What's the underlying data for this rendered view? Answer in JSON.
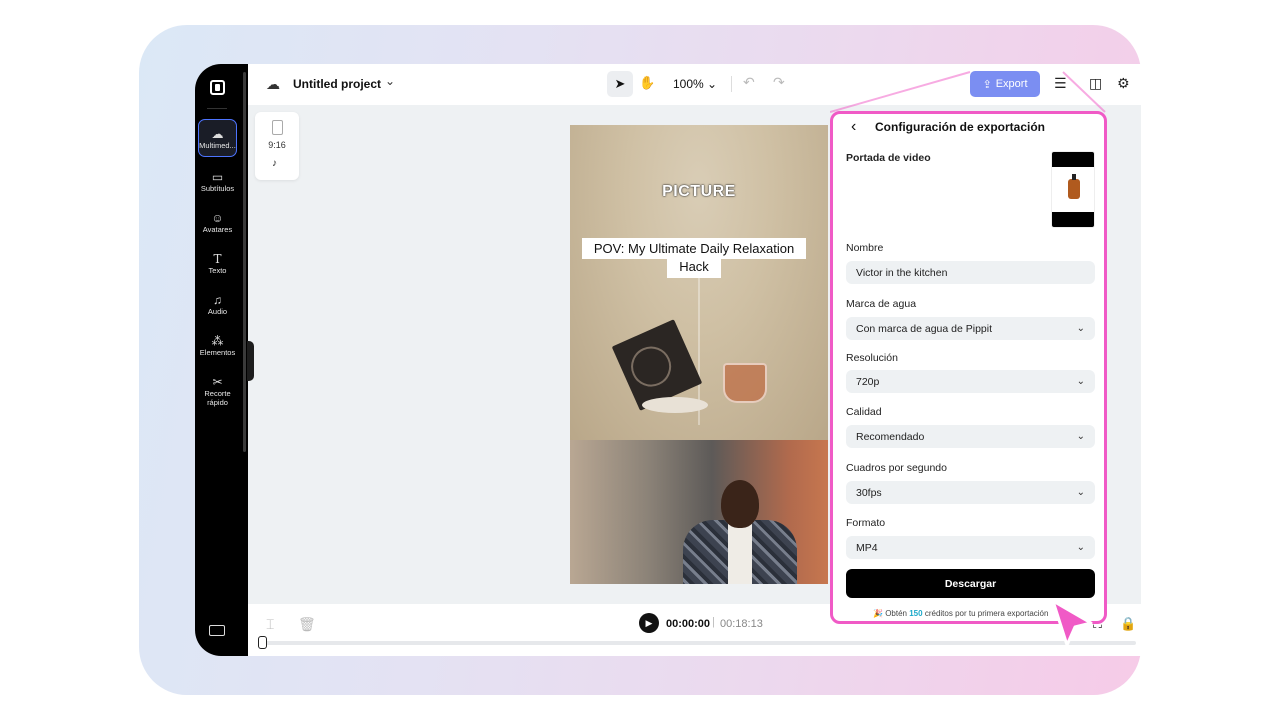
{
  "project": {
    "title": "Untitled project"
  },
  "toolbar": {
    "zoom": "100%",
    "export_label": "Export"
  },
  "sidebar": {
    "items": [
      {
        "label": "Multimed...",
        "icon": "cloud-upload-icon"
      },
      {
        "label": "Subtítulos",
        "icon": "subtitles-icon"
      },
      {
        "label": "Avatares",
        "icon": "avatar-icon"
      },
      {
        "label": "Texto",
        "icon": "text-icon"
      },
      {
        "label": "Audio",
        "icon": "music-icon"
      },
      {
        "label": "Elementos",
        "icon": "elements-icon"
      },
      {
        "label": "Recorte rápido",
        "icon": "quick-cut-icon"
      }
    ]
  },
  "canvas": {
    "aspect_ratio": "9:16",
    "video_title_overlay": "PICTURE",
    "video_caption": "POV: My Ultimate Daily Relaxation",
    "video_caption_line2": "Hack"
  },
  "playback": {
    "current_time": "00:00:00",
    "separator": "|",
    "total_time": "00:18:13"
  },
  "export_panel": {
    "title": "Configuración de exportación",
    "cover_label": "Portada de video",
    "name_label": "Nombre",
    "name_value": "Victor in the kitchen",
    "watermark_label": "Marca de agua",
    "watermark_value": "Con marca de agua de Pippit",
    "resolution_label": "Resolución",
    "resolution_value": "720p",
    "quality_label": "Calidad",
    "quality_value": "Recomendado",
    "fps_label": "Cuadros por segundo",
    "fps_value": "30fps",
    "format_label": "Formato",
    "format_value": "MP4",
    "download_label": "Descargar",
    "promo_prefix": "Obtén",
    "promo_credits": "150",
    "promo_suffix": "créditos por tu primera exportación"
  },
  "colors": {
    "accent_pink": "#f05ac6",
    "export_button": "#7b8ef2",
    "credits_highlight": "#1aa9c9"
  }
}
